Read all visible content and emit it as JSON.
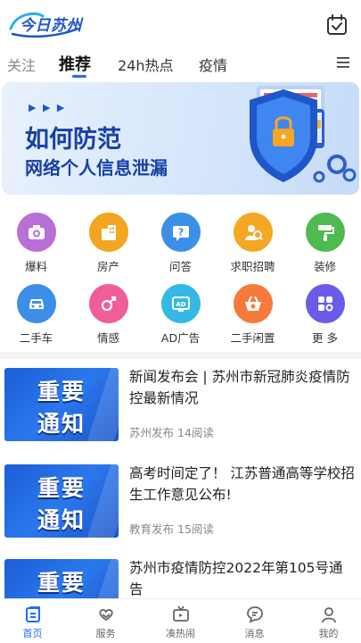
{
  "header": {
    "logo_text": "今日苏州",
    "calendar_icon": "calendar-check-icon"
  },
  "tabs": [
    {
      "label": "关注",
      "active": false
    },
    {
      "label": "推荐",
      "active": true
    },
    {
      "label": "24h热点",
      "active": false
    },
    {
      "label": "疫情",
      "active": false
    }
  ],
  "menu_icon": "hamburger-menu-icon",
  "banner": {
    "arrows": "▶ ▶ ▶",
    "title": "如何防范",
    "subtitle": "网络个人信息泄漏",
    "slide_count": 3,
    "active_slide": 1
  },
  "grid": [
    {
      "label": "爆料",
      "icon": "camera-icon",
      "color": "#b86fd6"
    },
    {
      "label": "房产",
      "icon": "building-icon",
      "color": "#f2a51e"
    },
    {
      "label": "问答",
      "icon": "question-icon",
      "color": "#3c8fe6"
    },
    {
      "label": "求职招聘",
      "icon": "job-icon",
      "color": "#f5a623"
    },
    {
      "label": "装修",
      "icon": "paint-roller-icon",
      "color": "#4fba4f"
    },
    {
      "label": "二手车",
      "icon": "car-icon",
      "color": "#3d8ee8"
    },
    {
      "label": "情感",
      "icon": "gender-icon",
      "color": "#ef5d9a"
    },
    {
      "label": "AD广告",
      "icon": "ad-icon",
      "color": "#35b8e6"
    },
    {
      "label": "二手闲置",
      "icon": "basket-icon",
      "color": "#f57a3c"
    },
    {
      "label": "更 多",
      "icon": "more-grid-icon",
      "color": "#6a5ce8"
    }
  ],
  "news": [
    {
      "thumb_line1": "重要",
      "thumb_line2": "通知",
      "title": "新闻发布会 | 苏州市新冠肺炎疫情防控最新情况",
      "source": "苏州发布",
      "reads": "14阅读"
    },
    {
      "thumb_line1": "重要",
      "thumb_line2": "通知",
      "title": "高考时间定了！ 江苏普通高等学校招生工作意见公布!",
      "source": "教育发布",
      "reads": "15阅读"
    },
    {
      "thumb_line1": "重要",
      "thumb_line2": "通知",
      "title": "苏州市疫情防控2022年第105号通告",
      "source": "",
      "reads": ""
    }
  ],
  "bottom_nav": [
    {
      "label": "首页",
      "icon": "home-icon",
      "active": true
    },
    {
      "label": "服务",
      "icon": "heart-hands-icon",
      "active": false
    },
    {
      "label": "凑热闹",
      "icon": "tv-icon",
      "active": false
    },
    {
      "label": "消息",
      "icon": "chat-icon",
      "active": false
    },
    {
      "label": "我的",
      "icon": "user-icon",
      "active": false
    }
  ],
  "colors": {
    "accent": "#1f6bff",
    "brand_blue": "#1740a6"
  }
}
